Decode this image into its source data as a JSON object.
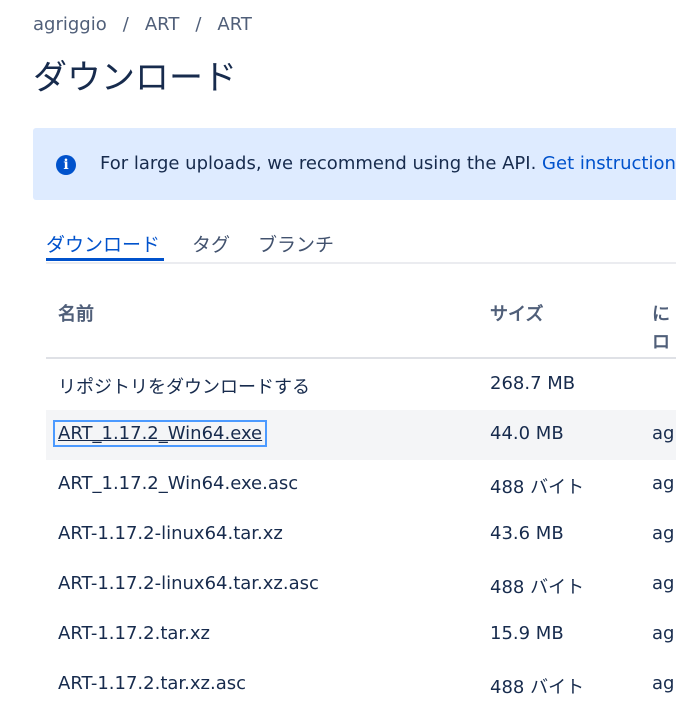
{
  "breadcrumb": {
    "items": [
      "agriggio",
      "ART",
      "ART"
    ],
    "separator": "/"
  },
  "page_title": "ダウンロード",
  "banner": {
    "icon": "info-icon",
    "text": "For large uploads, we recommend using the API. ",
    "link": "Get instructions"
  },
  "tabs": [
    {
      "label": "ダウンロード",
      "active": true
    },
    {
      "label": "タグ",
      "active": false
    },
    {
      "label": "ブランチ",
      "active": false
    }
  ],
  "table": {
    "headers": {
      "name": "名前",
      "size": "サイズ",
      "uploaded_by_line1": "に",
      "uploaded_by_line2": "ロ"
    },
    "rows": [
      {
        "name": "リポジトリをダウンロードする",
        "size": "268.7 MB",
        "user": ""
      },
      {
        "name": "ART_1.17.2_Win64.exe",
        "size": "44.0 MB",
        "user": "agr"
      },
      {
        "name": "ART_1.17.2_Win64.exe.asc",
        "size": "488 バイト",
        "user": "agr"
      },
      {
        "name": "ART-1.17.2-linux64.tar.xz",
        "size": "43.6 MB",
        "user": "agr"
      },
      {
        "name": "ART-1.17.2-linux64.tar.xz.asc",
        "size": "488 バイト",
        "user": "agr"
      },
      {
        "name": "ART-1.17.2.tar.xz",
        "size": "15.9 MB",
        "user": "agr"
      },
      {
        "name": "ART-1.17.2.tar.xz.asc",
        "size": "488 バイト",
        "user": "agr"
      }
    ]
  },
  "colors": {
    "accent": "#0052cc",
    "banner_bg": "#deebff",
    "row_highlight": "#f4f5f7"
  }
}
